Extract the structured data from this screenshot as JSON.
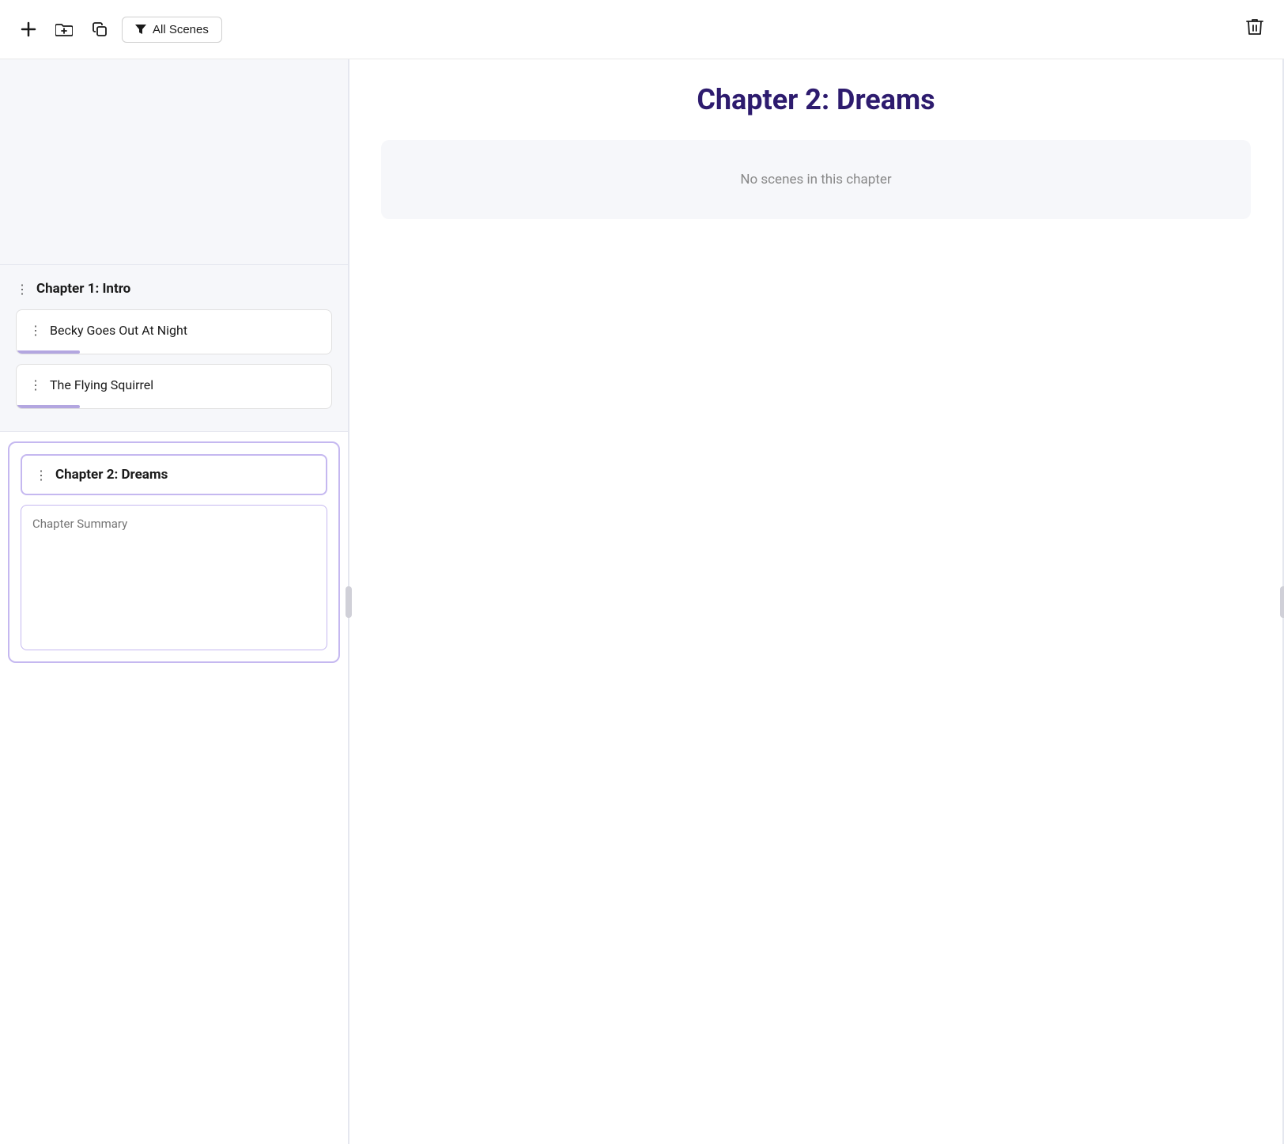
{
  "toolbar": {
    "add_label": "+",
    "add_folder_label": "⊞",
    "copy_label": "⧉",
    "filter_label": "All Scenes",
    "delete_label": "🗑"
  },
  "left_panel": {
    "chapter1": {
      "title": "Chapter 1: Intro",
      "scenes": [
        {
          "id": 1,
          "title": "Becky Goes Out At Night"
        },
        {
          "id": 2,
          "title": "The Flying Squirrel"
        }
      ]
    },
    "chapter2": {
      "title": "Chapter 2: Dreams",
      "summary_placeholder": "Chapter Summary"
    }
  },
  "right_panel": {
    "chapter_title": "Chapter 2: Dreams",
    "no_scenes_text": "No scenes in this chapter"
  },
  "icons": {
    "drag_dots": "⋮",
    "plus": "+",
    "trash": "🗑",
    "filter": "▼"
  }
}
